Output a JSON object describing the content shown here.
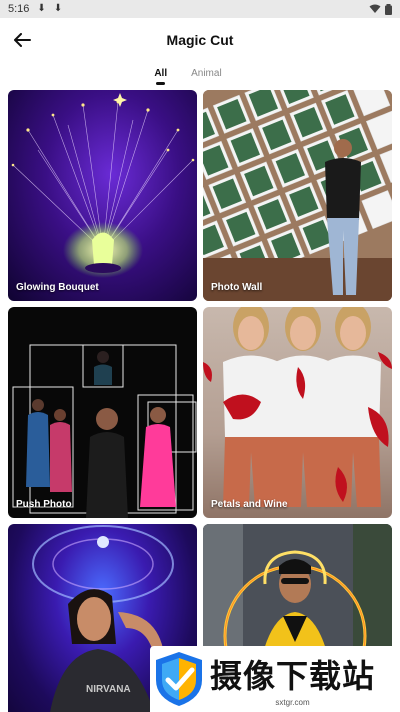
{
  "status_bar": {
    "time": "5:16"
  },
  "header": {
    "title": "Magic Cut"
  },
  "tabs": [
    {
      "label": "All",
      "active": true
    },
    {
      "label": "Animal",
      "active": false
    }
  ],
  "templates": [
    {
      "label": "Glowing Bouquet"
    },
    {
      "label": "Photo Wall"
    },
    {
      "label": "Push Photo"
    },
    {
      "label": "Petals and Wine"
    },
    {
      "label": ""
    },
    {
      "label": ""
    }
  ],
  "watermark": {
    "title": "摄像下载站",
    "url": "sxtgr.com"
  },
  "colors": {
    "accent": "#111111",
    "tab_inactive": "#888888",
    "status_bar_bg": "#e9e9e9"
  }
}
